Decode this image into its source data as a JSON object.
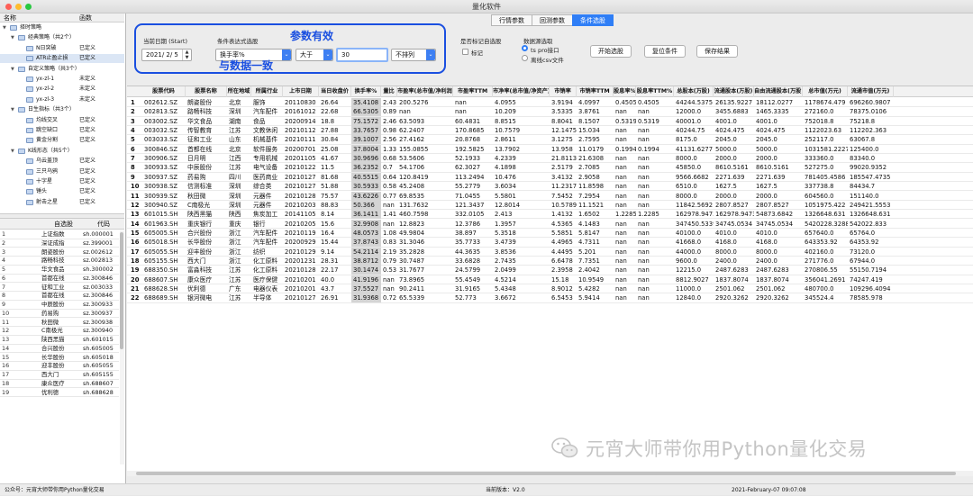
{
  "window": {
    "title": "量化软件"
  },
  "tabs": [
    {
      "label": "行情参数",
      "active": false
    },
    {
      "label": "回测参数",
      "active": false
    },
    {
      "label": "条件选股",
      "active": true
    }
  ],
  "sidebar": {
    "header": {
      "name": "名称",
      "func": "函数"
    },
    "tree": [
      {
        "label": "择时策略",
        "status": "",
        "level": 0
      },
      {
        "label": "经典策略（共2个）",
        "status": "",
        "level": 1
      },
      {
        "label": "N日突破",
        "status": "已定义",
        "level": 2
      },
      {
        "label": "ATR止盈止损",
        "status": "已定义",
        "level": 2
      },
      {
        "label": "自定义策略（共3个）",
        "status": "",
        "level": 1
      },
      {
        "label": "yx-zl-1",
        "status": "未定义",
        "level": 2
      },
      {
        "label": "yx-zl-2",
        "status": "未定义",
        "level": 2
      },
      {
        "label": "yx-zl-3",
        "status": "未定义",
        "level": 2
      },
      {
        "label": "日生指标（共3个）",
        "status": "",
        "level": 1
      },
      {
        "label": "均线交叉",
        "status": "已定义",
        "level": 2
      },
      {
        "label": "跳空缺口",
        "status": "已定义",
        "level": 2
      },
      {
        "label": "黄金分割",
        "status": "已定义",
        "level": 2
      },
      {
        "label": "K线形态（共5个）",
        "status": "",
        "level": 1
      },
      {
        "label": "乌云盖顶",
        "status": "已定义",
        "level": 2
      },
      {
        "label": "三只乌鸦",
        "status": "已定义",
        "level": 2
      },
      {
        "label": "十字星",
        "status": "已定义",
        "level": 2
      },
      {
        "label": "锤头",
        "status": "已定义",
        "level": 2
      },
      {
        "label": "射击之星",
        "status": "已定义",
        "level": 2
      }
    ],
    "stock_header": {
      "name": "自选股",
      "code": "代码"
    },
    "stocks": [
      {
        "n": "1",
        "name": "上证指数",
        "code": "sh.000001"
      },
      {
        "n": "2",
        "name": "深证成指",
        "code": "sz.399001"
      },
      {
        "n": "3",
        "name": "朗姿股份",
        "code": "sz.002612"
      },
      {
        "n": "4",
        "name": "路畅科技",
        "code": "sz.002813"
      },
      {
        "n": "5",
        "name": "华文食品",
        "code": "sh.300002"
      },
      {
        "n": "6",
        "name": "首都在线",
        "code": "sz.300846"
      },
      {
        "n": "7",
        "name": "征和工业",
        "code": "sz.003033"
      },
      {
        "n": "8",
        "name": "首都在线",
        "code": "sz.300846"
      },
      {
        "n": "9",
        "name": "中辰股份",
        "code": "sz.300933"
      },
      {
        "n": "10",
        "name": "药易购",
        "code": "sz.300937"
      },
      {
        "n": "11",
        "name": "秋田微",
        "code": "sz.300938"
      },
      {
        "n": "12",
        "name": "C南极光",
        "code": "sz.300940"
      },
      {
        "n": "13",
        "name": "陕西黑猫",
        "code": "sh.601015"
      },
      {
        "n": "14",
        "name": "合兴股份",
        "code": "sh.605005"
      },
      {
        "n": "15",
        "name": "长华股份",
        "code": "sh.605018"
      },
      {
        "n": "16",
        "name": "迎丰股份",
        "code": "sh.605055"
      },
      {
        "n": "17",
        "name": "西大门",
        "code": "sh.605155"
      },
      {
        "n": "18",
        "name": "康众医疗",
        "code": "sh.688607"
      },
      {
        "n": "19",
        "name": "优利德",
        "code": "sh.688628"
      }
    ]
  },
  "panel": {
    "date_label": "当前日期 (Start)",
    "date_value": "2021/ 2/ 5",
    "cond_label": "条件表达式选股",
    "cond_field": "换手率%",
    "cond_op": "大于",
    "cond_value": "30",
    "cond_sort": "不排列",
    "auto_label": "是否标记自选股",
    "auto_check": "标记",
    "source_label": "数据源选取",
    "source_opt1": "ts pro接口",
    "source_opt2": "离线csv文件",
    "btn_start": "开始选股",
    "btn_reset": "复位条件",
    "btn_save": "保存结果",
    "annot_top": "参数有效",
    "annot_bottom": "与数据一致"
  },
  "table": {
    "columns": [
      "股票代码",
      "股票名称",
      "所在地域",
      "所属行业",
      "上市日期",
      "当日收盘价",
      "换手率%",
      "量比",
      "市盈率(总市值/净利润)",
      "市盈率TTM",
      "市净率(总市值/净资产)",
      "市销率",
      "市销率TTM",
      "股息率%",
      "股息率TTM%",
      "总股本(万股)",
      "流通股本(万股)",
      "自由流通股本(万股)",
      "总市值(万元)",
      "流通市值(万元)"
    ],
    "rows": [
      [
        "1",
        "002612.SZ",
        "朗姿股份",
        "北京",
        "服饰",
        "20110830",
        "26.64",
        "35.4108",
        "2.43",
        "200.5276",
        "nan",
        "4.0955",
        "3.9194",
        "4.0997",
        "0.4505",
        "0.4505",
        "44244.5375",
        "26135.9227",
        "18112.0277",
        "1178674.479",
        "696260.9807"
      ],
      [
        "2",
        "002813.SZ",
        "路畅科技",
        "深圳",
        "汽车配件",
        "20161012",
        "22.68",
        "66.5305",
        "0.89",
        "nan",
        "nan",
        "10.209",
        "3.5335",
        "3.8761",
        "nan",
        "nan",
        "12000.0",
        "3455.6883",
        "1465.3335",
        "272160.0",
        "78375.0106"
      ],
      [
        "3",
        "003002.SZ",
        "华文食品",
        "湖南",
        "食品",
        "20200914",
        "18.8",
        "75.1572",
        "2.46",
        "63.5093",
        "60.4831",
        "8.8515",
        "8.8041",
        "8.1507",
        "0.5319",
        "0.5319",
        "40001.0",
        "4001.0",
        "4001.0",
        "752018.8",
        "75218.8"
      ],
      [
        "4",
        "003032.SZ",
        "传智教育",
        "江苏",
        "文教休闲",
        "20210112",
        "27.88",
        "33.7657",
        "0.98",
        "62.2407",
        "170.8685",
        "10.7579",
        "12.1475",
        "15.034",
        "nan",
        "nan",
        "40244.75",
        "4024.475",
        "4024.475",
        "1122023.63",
        "112202.363"
      ],
      [
        "5",
        "003033.SZ",
        "征和工业",
        "山东",
        "机械基件",
        "20210111",
        "30.84",
        "39.1007",
        "2.56",
        "27.4162",
        "20.8768",
        "2.8611",
        "3.1275",
        "2.7595",
        "nan",
        "nan",
        "8175.0",
        "2045.0",
        "2045.0",
        "252117.0",
        "63067.8"
      ],
      [
        "6",
        "300846.SZ",
        "首都在线",
        "北京",
        "软件服务",
        "20200701",
        "25.08",
        "37.8004",
        "1.33",
        "155.0855",
        "192.5825",
        "13.7902",
        "13.958",
        "11.0179",
        "0.1994",
        "0.1994",
        "41131.6277",
        "5000.0",
        "5000.0",
        "1031581.2227",
        "125400.0"
      ],
      [
        "7",
        "300906.SZ",
        "日月明",
        "江西",
        "专用机械",
        "20201105",
        "41.67",
        "30.9696",
        "0.68",
        "53.5606",
        "52.1933",
        "4.2339",
        "21.8113",
        "21.6308",
        "nan",
        "nan",
        "8000.0",
        "2000.0",
        "2000.0",
        "333360.0",
        "83340.0"
      ],
      [
        "8",
        "300933.SZ",
        "中辰股份",
        "江苏",
        "电气设备",
        "20210122",
        "11.5",
        "36.2352",
        "0.7",
        "54.1706",
        "62.3027",
        "4.1898",
        "2.5179",
        "2.7085",
        "nan",
        "nan",
        "45850.0",
        "8610.5161",
        "8610.5161",
        "527275.0",
        "99020.9352"
      ],
      [
        "9",
        "300937.SZ",
        "药易购",
        "四川",
        "医药商业",
        "20210127",
        "81.68",
        "40.5515",
        "0.64",
        "120.8419",
        "113.2494",
        "10.476",
        "3.4132",
        "2.9058",
        "nan",
        "nan",
        "9566.6682",
        "2271.639",
        "2271.639",
        "781405.4586",
        "185547.4735"
      ],
      [
        "10",
        "300938.SZ",
        "信测标准",
        "深圳",
        "综合类",
        "20210127",
        "51.88",
        "30.5933",
        "0.58",
        "45.2408",
        "55.2779",
        "3.6034",
        "11.2317",
        "11.8598",
        "nan",
        "nan",
        "6510.0",
        "1627.5",
        "1627.5",
        "337738.8",
        "84434.7"
      ],
      [
        "11",
        "300939.SZ",
        "秋田微",
        "深圳",
        "元器件",
        "20210128",
        "75.57",
        "43.6226",
        "0.77",
        "69.8535",
        "71.0455",
        "5.5801",
        "7.5452",
        "7.2954",
        "nan",
        "nan",
        "8000.0",
        "2000.0",
        "2000.0",
        "604560.0",
        "151140.0"
      ],
      [
        "12",
        "300940.SZ",
        "C南极光",
        "深圳",
        "元器件",
        "20210203",
        "88.83",
        "50.366",
        "nan",
        "131.7632",
        "121.3437",
        "12.8014",
        "10.5789",
        "11.1521",
        "nan",
        "nan",
        "11842.5692",
        "2807.8527",
        "2807.8527",
        "1051975.422",
        "249421.5553"
      ],
      [
        "13",
        "601015.SH",
        "陕西黑猫",
        "陕西",
        "焦炭加工",
        "20141105",
        "8.14",
        "36.1411",
        "1.41",
        "460.7598",
        "332.0105",
        "2.413",
        "1.4132",
        "1.6502",
        "1.2285",
        "1.2285",
        "162978.9473",
        "162978.9473",
        "54873.6842",
        "1326648.631",
        "1326648.631"
      ],
      [
        "14",
        "601963.SH",
        "重庆银行",
        "重庆",
        "银行",
        "20210205",
        "15.6",
        "32.9908",
        "nan",
        "12.8823",
        "12.3786",
        "1.3957",
        "4.5365",
        "4.1483",
        "nan",
        "nan",
        "347450.5339",
        "34745.0534",
        "34745.0534",
        "5420228.3288",
        "542022.833"
      ],
      [
        "15",
        "605005.SH",
        "合兴股份",
        "浙江",
        "汽车配件",
        "20210119",
        "16.4",
        "48.0573",
        "1.08",
        "49.9804",
        "38.897",
        "5.3518",
        "5.5851",
        "5.8147",
        "nan",
        "nan",
        "40100.0",
        "4010.0",
        "4010.0",
        "657640.0",
        "65764.0"
      ],
      [
        "16",
        "605018.SH",
        "长华股份",
        "浙江",
        "汽车配件",
        "20200929",
        "15.44",
        "37.8743",
        "0.83",
        "31.3046",
        "35.7733",
        "3.4739",
        "4.4965",
        "4.7311",
        "nan",
        "nan",
        "41668.0",
        "4168.0",
        "4168.0",
        "643353.92",
        "64353.92"
      ],
      [
        "17",
        "605055.SH",
        "迎丰股份",
        "浙江",
        "纺织",
        "20210129",
        "9.14",
        "54.2114",
        "2.19",
        "35.2828",
        "44.3635",
        "3.8536",
        "4.4495",
        "5.201",
        "nan",
        "nan",
        "44000.0",
        "8000.0",
        "8000.0",
        "402160.0",
        "73120.0"
      ],
      [
        "18",
        "605155.SH",
        "西大门",
        "浙江",
        "化工原料",
        "20201231",
        "28.31",
        "38.8712",
        "0.79",
        "30.7487",
        "33.6828",
        "2.7435",
        "6.6478",
        "7.7351",
        "nan",
        "nan",
        "9600.0",
        "2400.0",
        "2400.0",
        "271776.0",
        "67944.0"
      ],
      [
        "19",
        "688350.SH",
        "富淼科技",
        "江苏",
        "化工原料",
        "20210128",
        "22.17",
        "30.1474",
        "0.53",
        "31.7677",
        "24.5799",
        "2.0499",
        "2.3958",
        "2.4042",
        "nan",
        "nan",
        "12215.0",
        "2487.6283",
        "2487.6283",
        "270806.55",
        "55150.7194"
      ],
      [
        "20",
        "688607.SH",
        "康众医疗",
        "江苏",
        "医疗保健",
        "20210201",
        "40.0",
        "41.9196",
        "nan",
        "73.8965",
        "55.4549",
        "4.5214",
        "15.18",
        "10.9549",
        "nan",
        "nan",
        "8812.9027",
        "1837.8074",
        "1837.8074",
        "356041.2691",
        "74247.419"
      ],
      [
        "21",
        "688628.SH",
        "优利德",
        "广东",
        "电器仪表",
        "20210201",
        "43.7",
        "37.5527",
        "nan",
        "90.2411",
        "31.9165",
        "5.4348",
        "8.9012",
        "5.4282",
        "nan",
        "nan",
        "11000.0",
        "2501.062",
        "2501.062",
        "480700.0",
        "109296.4094"
      ],
      [
        "22",
        "688689.SH",
        "银河微电",
        "江苏",
        "半导体",
        "20210127",
        "26.91",
        "31.9368",
        "0.72",
        "65.5339",
        "52.773",
        "3.6672",
        "6.5453",
        "5.9414",
        "nan",
        "nan",
        "12840.0",
        "2920.3262",
        "2920.3262",
        "345524.4",
        "78585.978"
      ]
    ]
  },
  "watermark": "元宵大师带你用Python量化交易",
  "status": {
    "left": "公众号：元宵大师带你用Python量化交易",
    "version": "当前版本：V2.0",
    "time": "2021-February-07 09:07:08"
  },
  "colors": {
    "accent": "#2f7ef6",
    "annotation": "#1a4fe0"
  }
}
